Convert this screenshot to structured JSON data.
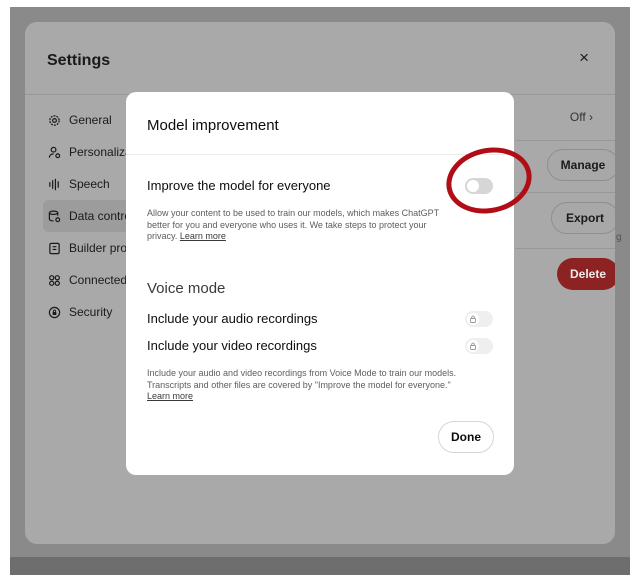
{
  "settings": {
    "title": "Settings",
    "close_glyph": "×",
    "nav": [
      {
        "label": "General",
        "icon": "gear-icon"
      },
      {
        "label": "Personaliza",
        "icon": "personalize-icon"
      },
      {
        "label": "Speech",
        "icon": "waveform-icon"
      },
      {
        "label": "Data contro",
        "icon": "database-icon"
      },
      {
        "label": "Builder pro",
        "icon": "profile-card-icon"
      },
      {
        "label": "Connected",
        "icon": "apps-grid-icon"
      },
      {
        "label": "Security",
        "icon": "shield-lock-icon"
      }
    ],
    "off_value": "Off ›",
    "manage_label": "Manage",
    "export_label": "Export",
    "delete_label": "Delete",
    "edge_text": "g"
  },
  "modal": {
    "title": "Model improvement",
    "improve": {
      "label": "Improve the model for everyone",
      "enabled": false,
      "description": "Allow your content to be used to train our models, which makes ChatGPT better for you and everyone who uses it. We take steps to protect your privacy.",
      "link": "Learn more"
    },
    "voice": {
      "heading": "Voice mode",
      "audio_label": "Include your audio recordings",
      "video_label": "Include your video recordings",
      "audio_locked": true,
      "video_locked": true,
      "description": "Include your audio and video recordings from Voice Mode to train our models. Transcripts and other files are covered by \"Improve the model for everyone.\"",
      "link": "Learn more"
    },
    "done_label": "Done"
  },
  "colors": {
    "annotation_circle": "#b00d16",
    "delete_button": "#8c2222"
  }
}
